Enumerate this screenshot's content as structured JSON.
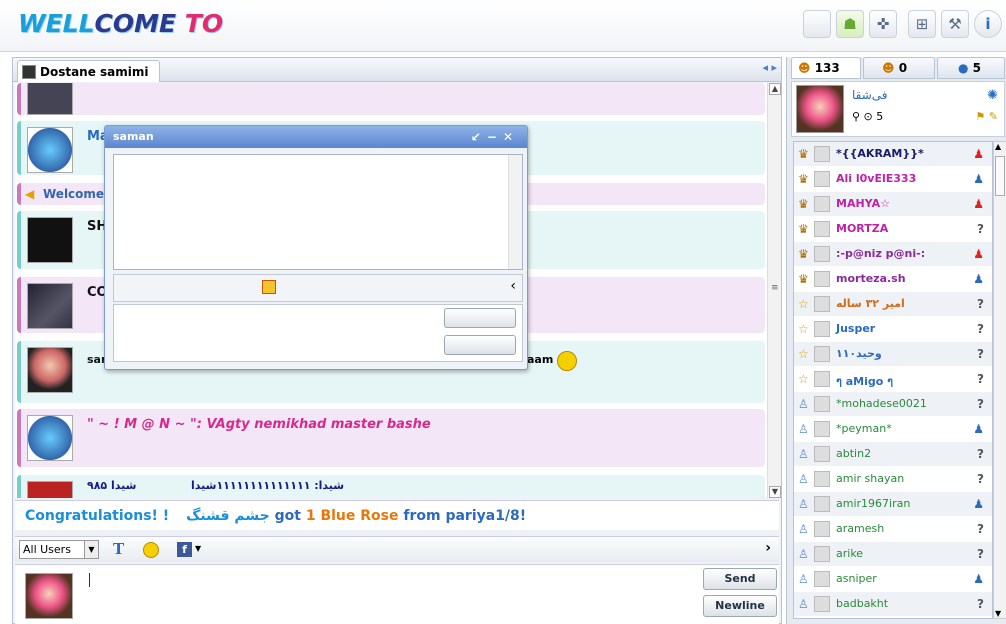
{
  "app": {
    "logo_text_1": "WELL",
    "logo_text_2": "COME ",
    "logo_text_3": "TO"
  },
  "top_icons": [
    "apple-icon",
    "android-icon",
    "gamepad-icon",
    "gift-icon",
    "wrench-icon",
    "info-icon"
  ],
  "room_tab": {
    "label": "Dostane samimi"
  },
  "messages": [
    {
      "text": "Ma"
    },
    {
      "text": "Welcome t"
    },
    {
      "text": "SH"
    },
    {
      "text": "CO"
    },
    {
      "text": "sar",
      "suffix": "aam"
    },
    {
      "text": "\" ~ ! M @ N ~ \": VAgty nemikhad master bashe"
    },
    {
      "text": "شیدا ۹۸۵",
      "text2": "شیدا: ۱۱۱۱۱۱۱۱۱۱۱۱۱۱شیدا"
    }
  ],
  "congrats": {
    "part1": "Congratulations! !",
    "name": "جشم قشنگ",
    "got": "got",
    "count": "1",
    "item": "Blue Rose",
    "from": "from pariya1/8!"
  },
  "input_toolbar": {
    "target": "All Users"
  },
  "buttons": {
    "send": "Send",
    "newline": "Newline"
  },
  "popup": {
    "title": "saman"
  },
  "side_tabs": [
    {
      "label": "133"
    },
    {
      "label": "0"
    },
    {
      "label": "5"
    }
  ],
  "me": {
    "name": "فی‌شقا",
    "coins": "5"
  },
  "users": [
    {
      "name": "*{{AKRAM}}*",
      "color": "#1a1a66",
      "gender": "female"
    },
    {
      "name": "Ali l0vElE333",
      "color": "#c021a8",
      "gender": "male"
    },
    {
      "name": "MAHYA☆",
      "color": "#c021a8",
      "gender": "female"
    },
    {
      "name": "MORTZA",
      "color": "#c021a8",
      "gender": "unknown"
    },
    {
      "name": ":-p@niz p@ni-:",
      "color": "#8a2a9a",
      "gender": "female"
    },
    {
      "name": "morteza.sh",
      "color": "#8a2a9a",
      "gender": "male"
    },
    {
      "name": "امیر ۳۲ ساله",
      "color": "#d26a1a",
      "gender": "unknown"
    },
    {
      "name": "Jusper",
      "color": "#2a6bc0",
      "gender": "unknown"
    },
    {
      "name": "وحید۱۱۰",
      "color": "#2a6bc0",
      "gender": "unknown"
    },
    {
      "name": "ๆ aMigo ๆ",
      "color": "#2a6bc0",
      "gender": "unknown"
    },
    {
      "name": "*mohadese0021",
      "color": "#2a8a3a",
      "gender": "unknown"
    },
    {
      "name": "*peyman*",
      "color": "#2a8a3a",
      "gender": "male"
    },
    {
      "name": "abtin2",
      "color": "#2a8a3a",
      "gender": "unknown"
    },
    {
      "name": "amir shayan",
      "color": "#2a8a3a",
      "gender": "unknown"
    },
    {
      "name": "amir1967iran",
      "color": "#2a8a3a",
      "gender": "male"
    },
    {
      "name": "aramesh",
      "color": "#2a8a3a",
      "gender": "unknown"
    },
    {
      "name": "arike",
      "color": "#2a8a3a",
      "gender": "unknown"
    },
    {
      "name": "asniper",
      "color": "#2a8a3a",
      "gender": "male"
    },
    {
      "name": "badbakht",
      "color": "#2a8a3a",
      "gender": "unknown"
    }
  ]
}
